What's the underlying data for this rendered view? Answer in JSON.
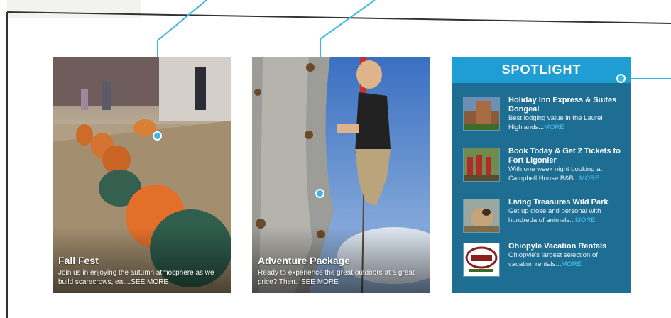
{
  "cards": [
    {
      "title": "Fall Fest",
      "desc": "Join us in enjoying the autumn atmosphere as we build scarecrows, eat...",
      "more": "SEE MORE",
      "image": "pumpkin-field-photo"
    },
    {
      "title": "Adventure Package",
      "desc": "Ready to experience the great outdoors at a great price? Then...",
      "more": "SEE MORE",
      "image": "boy-climbing-rock-wall-photo"
    }
  ],
  "spotlight": {
    "header": "SPOTLIGHT",
    "items": [
      {
        "title": "Holiday Inn Express & Suites Dongeal",
        "desc": "Best lodging value in the Laurel Highlands...",
        "more": "MORE",
        "thumb": "hotel-thumbnail"
      },
      {
        "title": "Book Today & Get 2 Tickets to Fort Ligonier",
        "desc": "With one week night booking at Campbell House B&B...",
        "more": "MORE",
        "thumb": "fort-soldiers-thumbnail"
      },
      {
        "title": "Living Treasures Wild Park",
        "desc": "Get up close and personal with hundreda of animals...",
        "more": "MORE",
        "thumb": "camel-thumbnail"
      },
      {
        "title": "Ohiopyle Vacation Rentals",
        "desc": "Ohiopyle's largest selection of vacation rentals...",
        "more": "MORE",
        "thumb": "ovr-logo-thumbnail"
      }
    ]
  },
  "colors": {
    "spotlight_bg": "#1e6d93",
    "spotlight_header": "#1e9ed3",
    "more_link": "#4ac3f0",
    "annotation_line": "#3cb6e3"
  }
}
